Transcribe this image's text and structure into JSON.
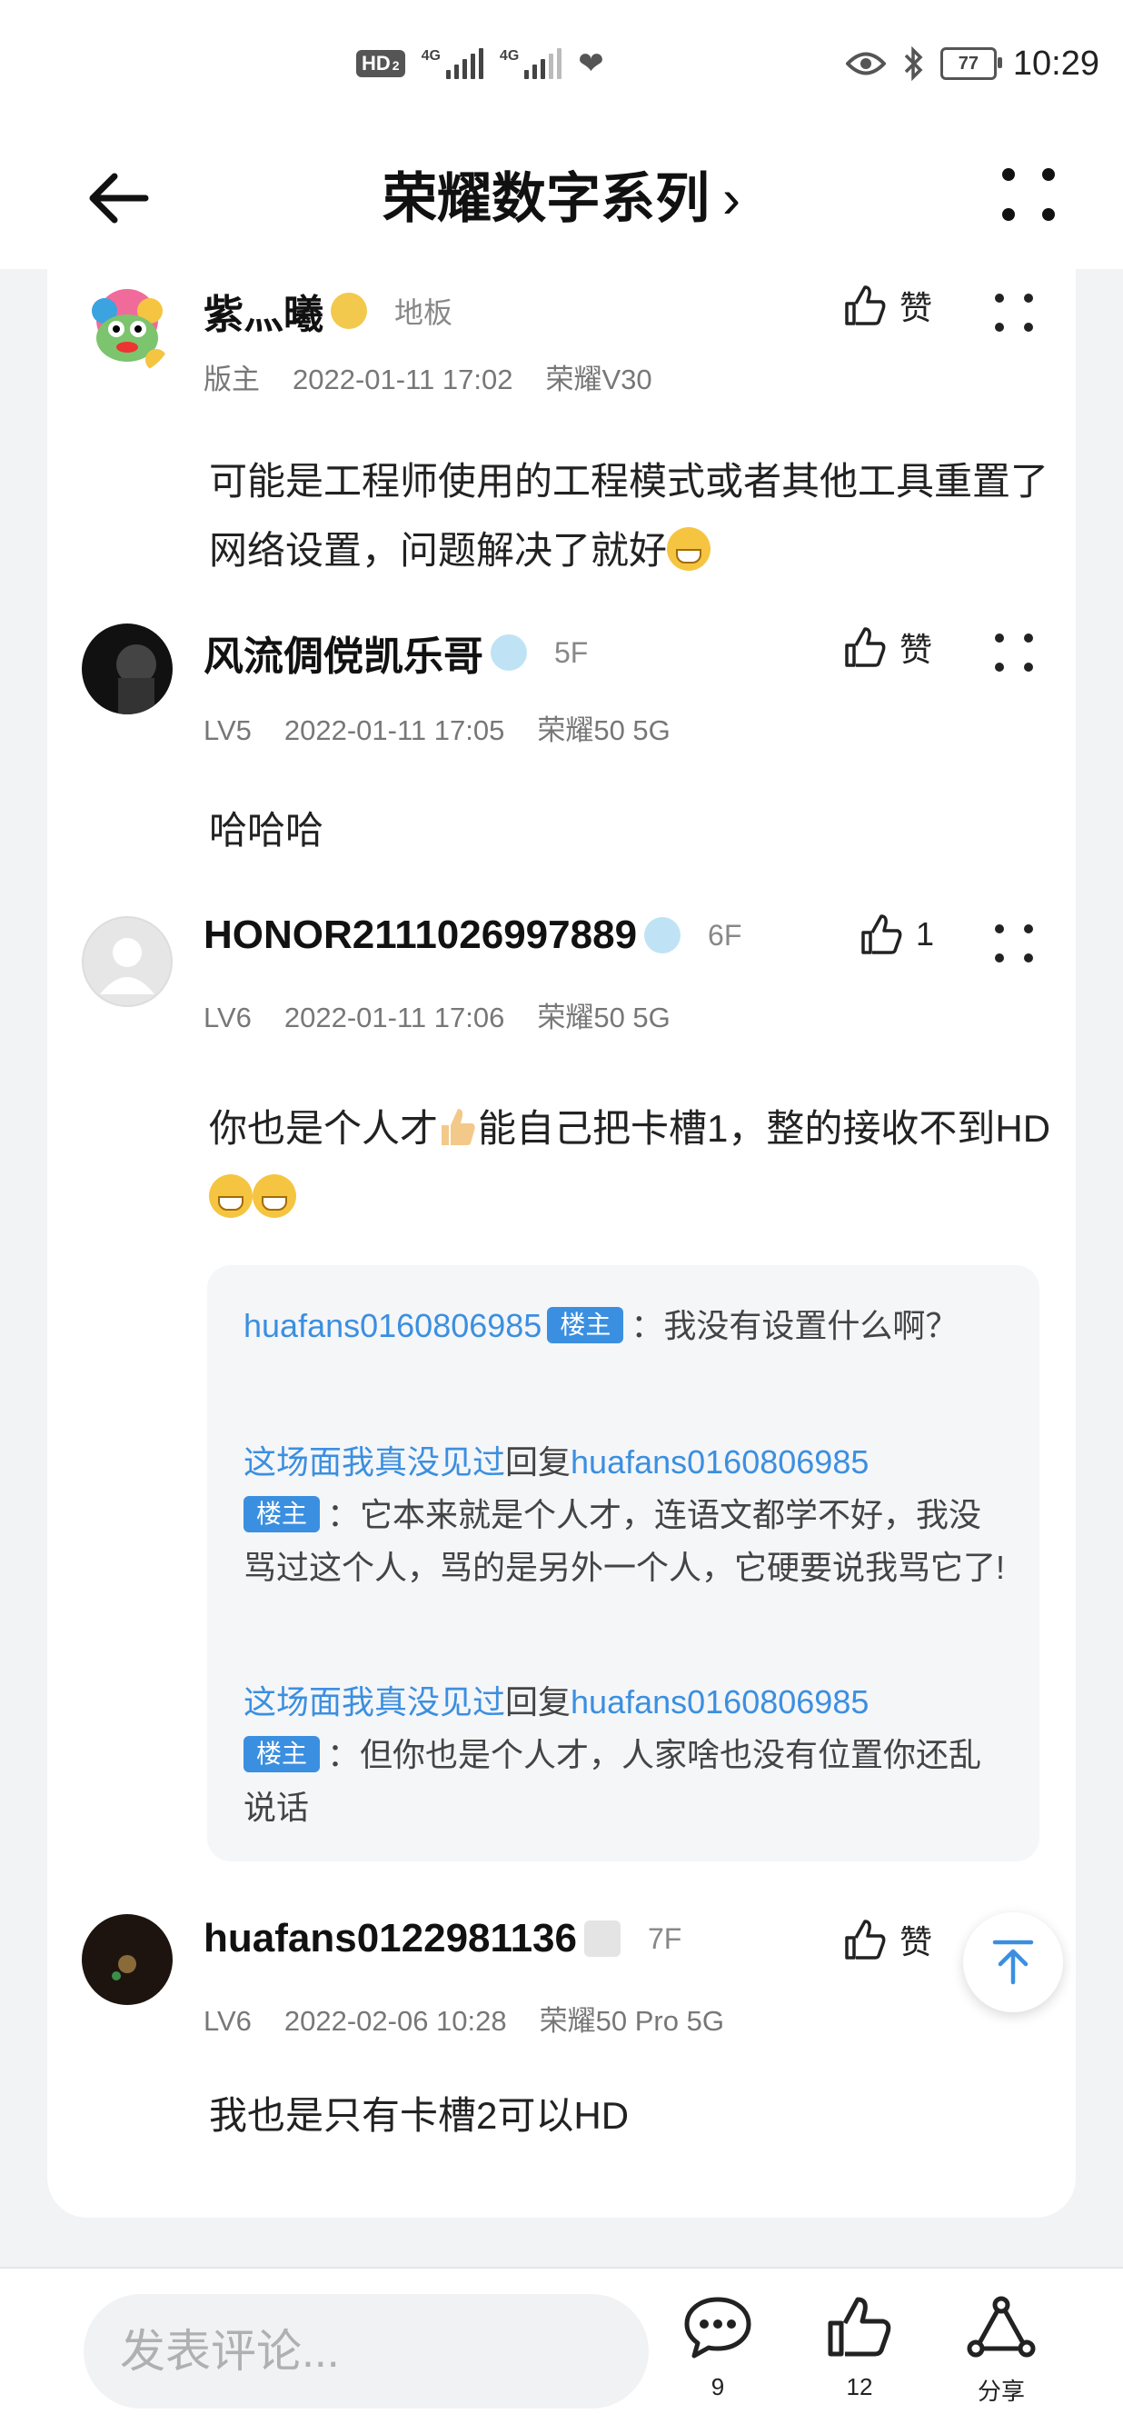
{
  "status_bar": {
    "hd": "HD",
    "sim2": "2",
    "net1": "4G",
    "net2": "4G",
    "battery": "77",
    "time": "10:29"
  },
  "header": {
    "title": "荣耀数字系列",
    "chevron": "›"
  },
  "posts": [
    {
      "username": "紫灬曦",
      "floor": "地板",
      "role": "版主",
      "date": "2022-01-11 17:02",
      "device": "荣耀V30",
      "like_label": "赞",
      "content": "可能是工程师使用的工程模式或者其他工具重置了网络设置，问题解决了就好"
    },
    {
      "username": "风流倜傥凯乐哥",
      "floor": "5F",
      "role": "LV5",
      "date": "2022-01-11 17:05",
      "device": "荣耀50 5G",
      "like_label": "赞",
      "content": "哈哈哈"
    },
    {
      "username": "HONOR2111026997889",
      "floor": "6F",
      "role": "LV6",
      "date": "2022-01-11 17:06",
      "device": "荣耀50 5G",
      "like_label": "1",
      "content_a": "你也是个人才",
      "content_b": "能自己把卡槽1，整的接收不到HD"
    },
    {
      "username": "huafans0122981136",
      "floor": "7F",
      "role": "LV6",
      "date": "2022-02-06 10:28",
      "device": "荣耀50 Pro 5G",
      "like_label": "赞",
      "content": "我也是只有卡槽2可以HD"
    }
  ],
  "replies": [
    {
      "user": "huafans0160806985",
      "badge": "楼主",
      "text": "：我没有设置什么啊？"
    },
    {
      "user": "这场面我真没见过",
      "verb": "回复",
      "target": "huafans0160806985",
      "badge": "楼主",
      "text": "：它本来就是个人才，连语文都学不好，我没骂过这个人，骂的是另外一个人，它硬要说我骂它了!"
    },
    {
      "user": "这场面我真没见过",
      "verb": "回复",
      "target": "huafans0160806985",
      "badge": "楼主",
      "text": "：但你也是个人才，人家啥也没有位置你还乱说话"
    }
  ],
  "bottom_bar": {
    "comment_placeholder": "发表评论...",
    "comments_count": "9",
    "likes_count": "12",
    "share_label": "分享"
  },
  "colors": {
    "link": "#3b8fe0",
    "badge_bg": "#3b8fe0",
    "card_bg": "#ffffff",
    "page_bg": "#f1f3f5"
  },
  "icons": [
    "back-arrow-icon",
    "more-icon",
    "thumb-up-icon",
    "comment-icon",
    "share-icon",
    "arrow-up-icon",
    "eye-icon",
    "bluetooth-icon",
    "heart-icon"
  ]
}
